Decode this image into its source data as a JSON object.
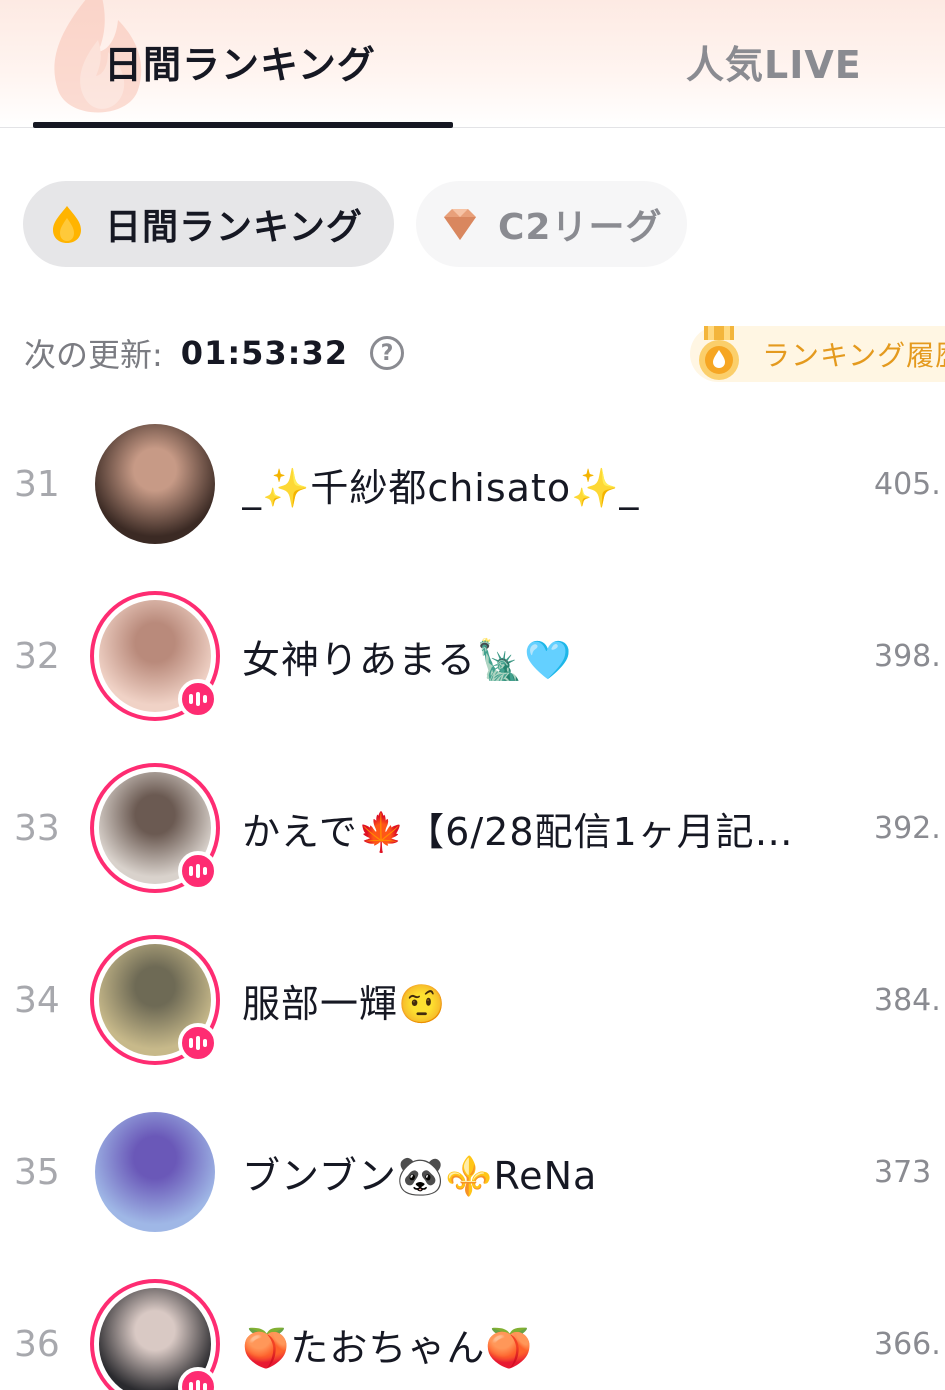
{
  "tabs": {
    "active": "日間ランキング",
    "inactive": "人気LIVE"
  },
  "chips": {
    "daily": "日間ランキング",
    "league": "C2リーグ"
  },
  "update": {
    "label": "次の更新:",
    "time": "01:53:32",
    "help": "?"
  },
  "history": {
    "label": "ランキング履歴"
  },
  "colors": {
    "live_pink": "#fe2c72",
    "gold": "#e49a1e",
    "text": "#161823",
    "muted": "#8a8b91"
  },
  "rows": [
    {
      "rank": "31",
      "name": "_✨千紗都chisato✨_",
      "score": "405.",
      "live": false
    },
    {
      "rank": "32",
      "name": "女神りあまる🗽🩵",
      "score": "398.",
      "live": true
    },
    {
      "rank": "33",
      "name": "かえで🍁【6/28配信1ヶ月記…",
      "score": "392.",
      "live": true
    },
    {
      "rank": "34",
      "name": "服部一輝🤨",
      "score": "384.",
      "live": true
    },
    {
      "rank": "35",
      "name": "ブンブン🐼⚜️ReNa",
      "score": "373",
      "live": false
    },
    {
      "rank": "36",
      "name": "🍑たおちゃん🍑",
      "score": "366.",
      "live": true
    }
  ]
}
